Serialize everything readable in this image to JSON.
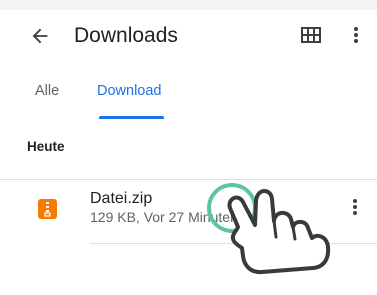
{
  "app_bar": {
    "title": "Downloads",
    "back_icon": "arrow-back-icon",
    "view_icon": "grid-view-icon",
    "menu_icon": "more-vert-icon"
  },
  "tabs": [
    {
      "label": "Alle",
      "selected": false
    },
    {
      "label": "Download",
      "selected": true
    }
  ],
  "section": {
    "heading": "Heute"
  },
  "files": [
    {
      "name": "Datei.zip",
      "meta": "129 KB, Vor 27 Minuten",
      "icon": "zip-file-icon",
      "icon_color": "#f57c00",
      "menu_icon": "more-vert-icon"
    }
  ],
  "overlay": {
    "gesture": "tap",
    "icon": "tap-hand-icon",
    "circle_color": "#5fc3a6"
  },
  "colors": {
    "accent": "#1a73e8",
    "text_primary": "#202124",
    "text_secondary": "#5f6368",
    "divider": "#e0e0e0"
  }
}
